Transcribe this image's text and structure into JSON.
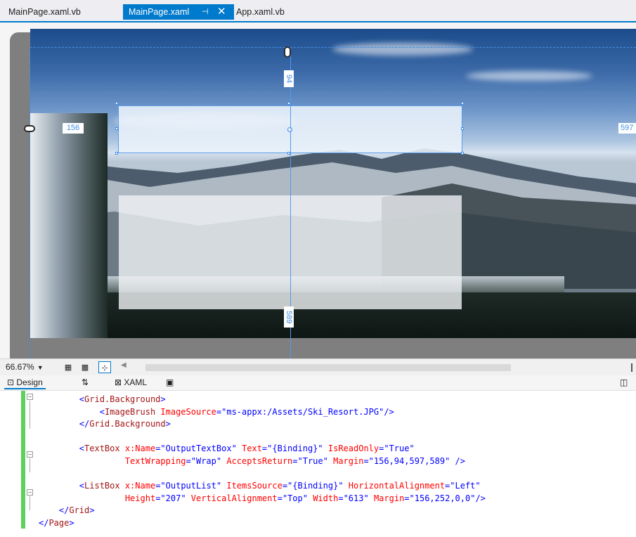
{
  "tabs": [
    {
      "label": "MainPage.xaml.vb",
      "active": false
    },
    {
      "label": "MainPage.xaml",
      "active": true
    },
    {
      "label": "App.xaml.vb",
      "active": false
    }
  ],
  "tab_icons": {
    "pin": "pin-icon",
    "close": "close-icon"
  },
  "designer": {
    "margin_left": "156",
    "margin_top": "94",
    "margin_right": "597",
    "margin_bottom": "589"
  },
  "zoom": {
    "level": "66.67%"
  },
  "view_switch": {
    "design": "Design",
    "swap": "⇅",
    "xaml": "XAML"
  },
  "code_lines": [
    {
      "indent": "        ",
      "parts": [
        [
          "br",
          "<"
        ],
        [
          "el",
          "Grid.Background"
        ],
        [
          "br",
          ">"
        ]
      ]
    },
    {
      "indent": "            ",
      "parts": [
        [
          "br",
          "<"
        ],
        [
          "el",
          "ImageBrush"
        ],
        [
          "at",
          " ImageSource"
        ],
        [
          "br",
          "=\""
        ],
        [
          "val",
          "ms-appx:/Assets/Ski_Resort.JPG"
        ],
        [
          "br",
          "\"/>"
        ]
      ]
    },
    {
      "indent": "        ",
      "parts": [
        [
          "br",
          "</"
        ],
        [
          "el",
          "Grid.Background"
        ],
        [
          "br",
          ">"
        ]
      ]
    },
    {
      "indent": "",
      "parts": []
    },
    {
      "indent": "        ",
      "parts": [
        [
          "br",
          "<"
        ],
        [
          "el",
          "TextBox"
        ],
        [
          "at",
          " x:Name"
        ],
        [
          "br",
          "=\""
        ],
        [
          "val",
          "OutputTextBox"
        ],
        [
          "br",
          "\""
        ],
        [
          "at",
          " Text"
        ],
        [
          "br",
          "=\""
        ],
        [
          "val",
          "{Binding}"
        ],
        [
          "br",
          "\""
        ],
        [
          "at",
          " IsReadOnly"
        ],
        [
          "br",
          "=\""
        ],
        [
          "val",
          "True"
        ],
        [
          "br",
          "\""
        ]
      ]
    },
    {
      "indent": "                 ",
      "parts": [
        [
          "at",
          "TextWrapping"
        ],
        [
          "br",
          "=\""
        ],
        [
          "val",
          "Wrap"
        ],
        [
          "br",
          "\""
        ],
        [
          "at",
          " AcceptsReturn"
        ],
        [
          "br",
          "=\""
        ],
        [
          "val",
          "True"
        ],
        [
          "br",
          "\""
        ],
        [
          "at",
          " Margin"
        ],
        [
          "br",
          "=\""
        ],
        [
          "val",
          "156,94,597,589"
        ],
        [
          "br",
          "\" />"
        ]
      ]
    },
    {
      "indent": "",
      "parts": []
    },
    {
      "indent": "        ",
      "parts": [
        [
          "br",
          "<"
        ],
        [
          "el",
          "ListBox"
        ],
        [
          "at",
          " x:Name"
        ],
        [
          "br",
          "=\""
        ],
        [
          "val",
          "OutputList"
        ],
        [
          "br",
          "\""
        ],
        [
          "at",
          " ItemsSource"
        ],
        [
          "br",
          "=\""
        ],
        [
          "val",
          "{Binding}"
        ],
        [
          "br",
          "\""
        ],
        [
          "at",
          " HorizontalAlignment"
        ],
        [
          "br",
          "=\""
        ],
        [
          "val",
          "Left"
        ],
        [
          "br",
          "\""
        ]
      ]
    },
    {
      "indent": "                 ",
      "parts": [
        [
          "at",
          "Height"
        ],
        [
          "br",
          "=\""
        ],
        [
          "val",
          "207"
        ],
        [
          "br",
          "\""
        ],
        [
          "at",
          " VerticalAlignment"
        ],
        [
          "br",
          "=\""
        ],
        [
          "val",
          "Top"
        ],
        [
          "br",
          "\""
        ],
        [
          "at",
          " Width"
        ],
        [
          "br",
          "=\""
        ],
        [
          "val",
          "613"
        ],
        [
          "br",
          "\""
        ],
        [
          "at",
          " Margin"
        ],
        [
          "br",
          "=\""
        ],
        [
          "val",
          "156,252,0,0"
        ],
        [
          "br",
          "\"/>"
        ]
      ]
    },
    {
      "indent": "    ",
      "parts": [
        [
          "br",
          "</"
        ],
        [
          "el",
          "Grid"
        ],
        [
          "br",
          ">"
        ]
      ]
    },
    {
      "indent": "",
      "parts": [
        [
          "br",
          "</"
        ],
        [
          "el",
          "Page"
        ],
        [
          "br",
          ">"
        ]
      ]
    }
  ],
  "colors": {
    "accent": "#007acc",
    "change_bar": "#5cd25c",
    "guide": "#3f8fe6"
  }
}
